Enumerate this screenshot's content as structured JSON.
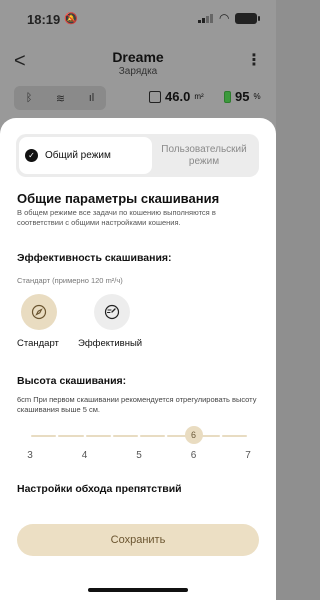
{
  "status_bar": {
    "time": "18:19"
  },
  "header": {
    "title": "Dreame",
    "subtitle": "Зарядка",
    "back_glyph": "<",
    "more_glyph": "⋮"
  },
  "device": {
    "area_value": "46.0",
    "area_unit": "m²",
    "battery_value": "95",
    "battery_unit": "%"
  },
  "mode": {
    "options": [
      {
        "label": "Общий режим",
        "selected": true
      },
      {
        "label": "Пользовательский режим",
        "selected": false
      }
    ]
  },
  "general": {
    "title": "Общие параметры скашивания",
    "description": "В общем режиме все задачи по кошению выполняются в соответствии с общими настройками кошения."
  },
  "efficiency": {
    "title": "Эффективность скашивания:",
    "note": "Стандарт (примерно 120 m²/ч)",
    "options": [
      {
        "label": "Стандарт",
        "icon": "compass-icon",
        "selected": true
      },
      {
        "label": "Эффективный",
        "icon": "speed-icon",
        "selected": false
      }
    ]
  },
  "height": {
    "title": "Высота скашивания:",
    "description": "6cm При первом скашивании рекомендуется отрегулировать высоту скашивания выше 5 см.",
    "min": 3,
    "max": 7,
    "value": 6,
    "value_label": "6",
    "ticks": [
      "3",
      "4",
      "5",
      "6",
      "7"
    ]
  },
  "obstacle": {
    "title": "Настройки обхода препятствий"
  },
  "save_button": {
    "label": "Сохранить"
  },
  "colors": {
    "accent": "#e9dcc1",
    "accent_text": "#6b5530",
    "battery": "#3c9a3c"
  }
}
